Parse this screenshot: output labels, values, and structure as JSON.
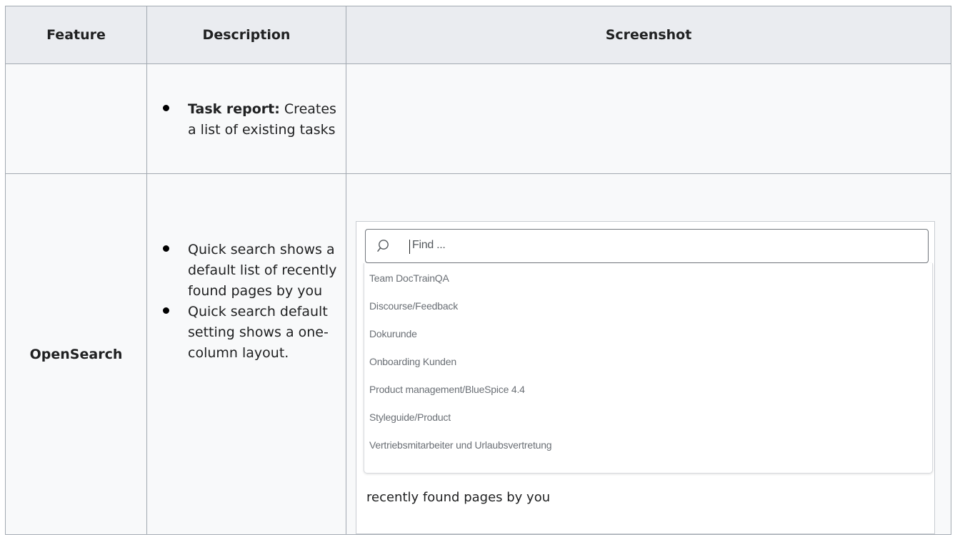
{
  "table": {
    "headers": [
      "Feature",
      "Description",
      "Screenshot"
    ],
    "rows": [
      {
        "feature": "",
        "items": [
          {
            "bold": "Task report:",
            "text": "Creates a list of existing tasks"
          }
        ]
      },
      {
        "feature": "OpenSearch",
        "items": [
          {
            "bold": "",
            "text": "Quick search shows a default list of recently found pages by you"
          },
          {
            "bold": "",
            "text": "Quick search default setting shows a one-column layout."
          }
        ],
        "screenshot": {
          "search_placeholder": "Find ...",
          "search_icon": "search-icon",
          "results": [
            "Team DocTrainQA",
            "Discourse/Feedback",
            "Dokurunde",
            "Onboarding Kunden",
            "Product management/BlueSpice 4.4",
            "Styleguide/Product",
            "Vertriebsmitarbeiter und Urlaubsvertretung"
          ],
          "caption": "recently found pages by you"
        }
      }
    ]
  }
}
